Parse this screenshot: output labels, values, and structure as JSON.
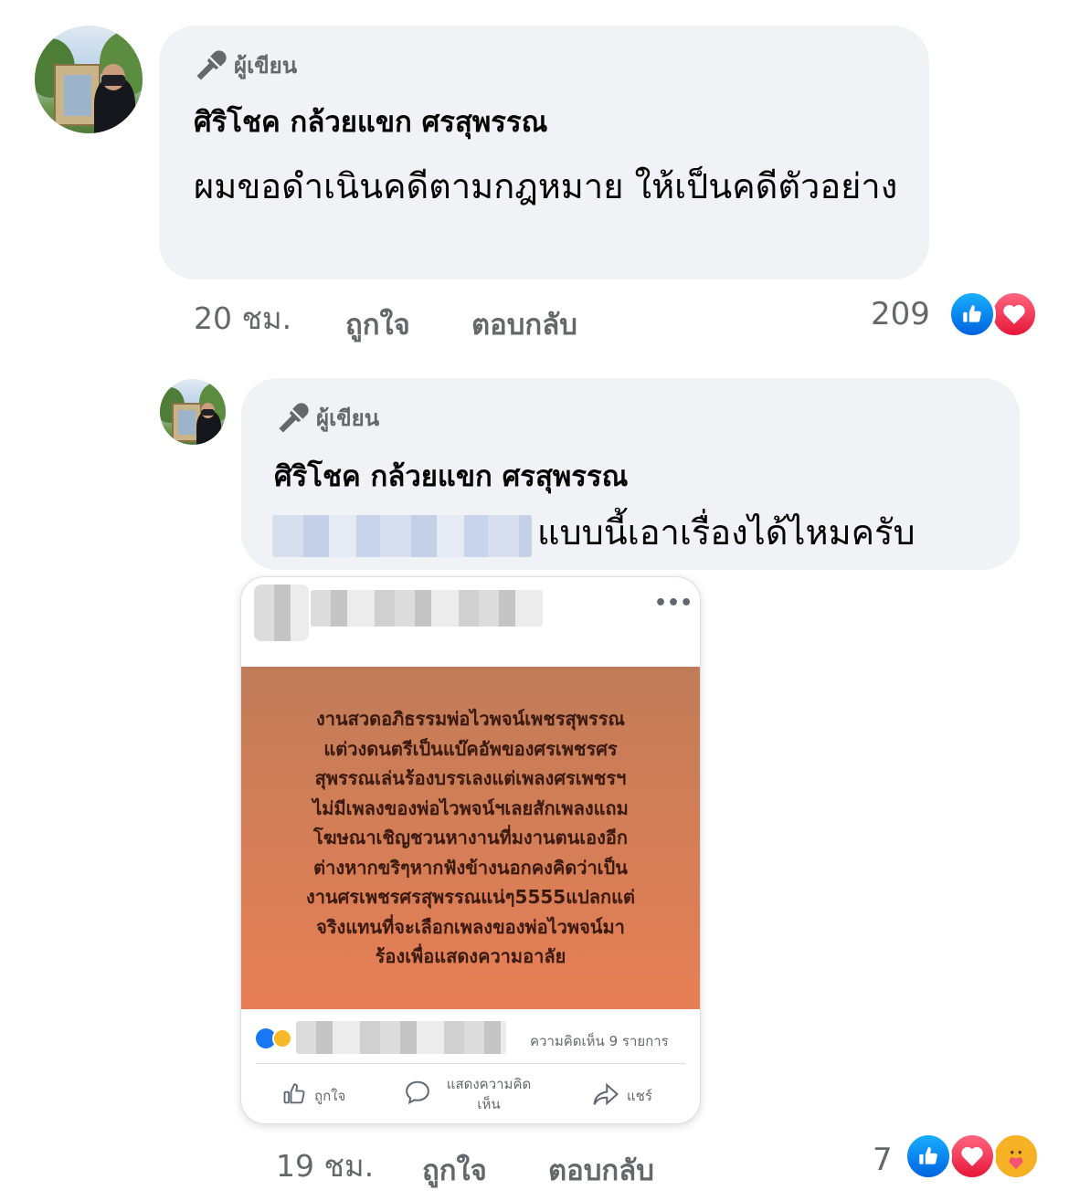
{
  "colors": {
    "bubble_bg": "#f0f2f5",
    "meta_text": "#65676b",
    "like_blue": "#0062df",
    "love_red": "#e61739",
    "care_yellow": "#f7b125",
    "post_orange": "#e77f56"
  },
  "comments": [
    {
      "author_badge": "ผู้เขียน",
      "author_badge_icon": "microphone-icon",
      "name": "ศิริโชค กล้วยแขก ศรสุพรรณ",
      "text": "ผมขอดำเนินคดีตามกฎหมาย ให้เป็นคดีตัวอย่าง",
      "time": "20 ชม.",
      "like_label": "ถูกใจ",
      "reply_label": "ตอบกลับ",
      "reaction_count": "209",
      "reactions": [
        "like-icon",
        "love-icon"
      ]
    },
    {
      "author_badge": "ผู้เขียน",
      "author_badge_icon": "microphone-icon",
      "name": "ศิริโชค กล้วยแขก ศรสุพรรณ",
      "text": "แบบนี้เอาเรื่องได้ไหมครับ",
      "mention_blurred": true,
      "time": "19 ชม.",
      "like_label": "ถูกใจ",
      "reply_label": "ตอบกลับ",
      "reaction_count": "7",
      "reactions": [
        "like-icon",
        "love-icon",
        "care-icon"
      ],
      "attachment": {
        "image_text": "งานสวดอภิธรรมพ่อไวพจน์เพชรสุพรรณ\nแต่วงดนตรีเป็นแบ๊คอัพของศรเพชรศร\nสุพรรณเล่นร้องบรรเลงแต่เพลงศรเพชรฯ\nไม่มีเพลงของพ่อไวพจน์ฯเลยสักเพลงแถม\nโฆษณาเชิญชวนหางานที่มงานตนเองอีก\nต่างหากขริๆหากฟังข้างนอกคงคิดว่าเป็น\nงานศรเพชรศรสุพรรณแน่ๆ5555แปลกแต่\nจริงแทนที่จะเลือกเพลงของพ่อไวพจน์มา\nร้องเพื่อแสดงความอาลัย",
        "comment_count": "ความคิดเห็น 9 รายการ",
        "like_label": "ถูกใจ",
        "comment_label": "แสดงความคิดเห็น",
        "share_label": "แชร์"
      }
    }
  ]
}
